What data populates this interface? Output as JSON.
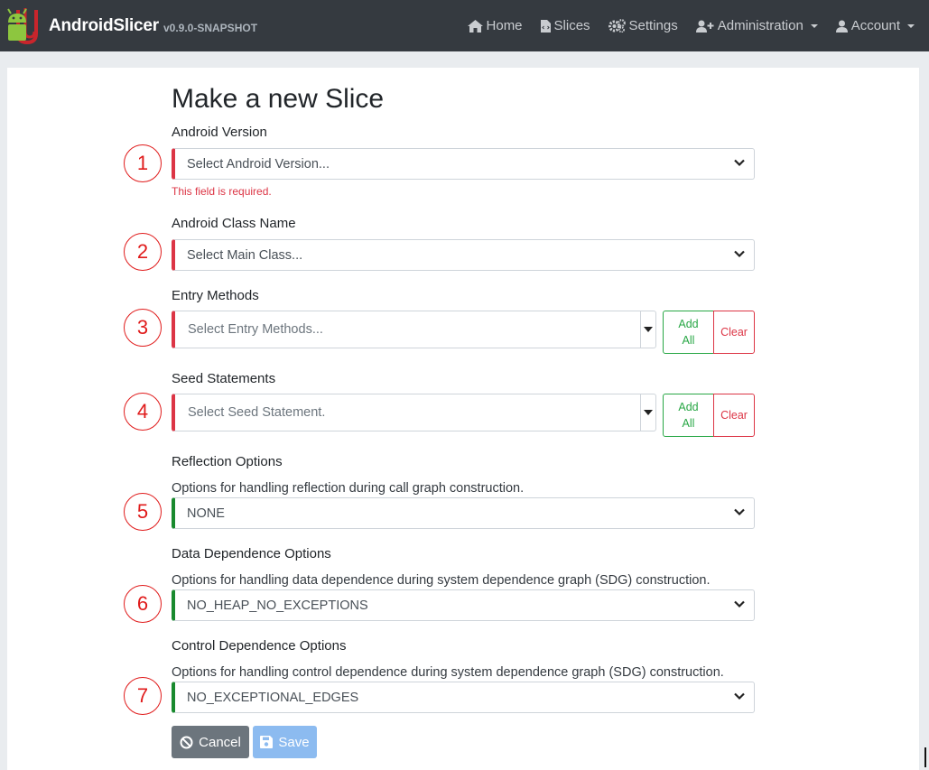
{
  "navbar": {
    "brand_name": "AndroidSlicer",
    "brand_version": "v0.9.0-SNAPSHOT",
    "items": {
      "home": "Home",
      "slices": "Slices",
      "settings": "Settings",
      "administration": "Administration",
      "account": "Account"
    }
  },
  "form": {
    "title": "Make a new Slice",
    "android_version": {
      "label": "Android Version",
      "placeholder": "Select Android Version...",
      "error": "This field is required.",
      "marker": "1"
    },
    "class_name": {
      "label": "Android Class Name",
      "placeholder": "Select Main Class...",
      "marker": "2"
    },
    "entry_methods": {
      "label": "Entry Methods",
      "placeholder": "Select Entry Methods...",
      "add_line1": "Add",
      "add_line2": "All",
      "clear": "Clear",
      "marker": "3"
    },
    "seed_statements": {
      "label": "Seed Statements",
      "placeholder": "Select Seed Statement.",
      "add_line1": "Add",
      "add_line2": "All",
      "clear": "Clear",
      "marker": "4"
    },
    "reflection": {
      "label": "Reflection Options",
      "help": "Options for handling reflection during call graph construction.",
      "value": "NONE",
      "marker": "5"
    },
    "data_dependence": {
      "label": "Data Dependence Options",
      "help": "Options for handling data dependence during system dependence graph (SDG) construction.",
      "value": "NO_HEAP_NO_EXCEPTIONS",
      "marker": "6"
    },
    "control_dependence": {
      "label": "Control Dependence Options",
      "help": "Options for handling control dependence during system dependence graph (SDG) construction.",
      "value": "NO_EXCEPTIONAL_EDGES",
      "marker": "7"
    },
    "cancel_label": "Cancel",
    "save_label": "Save"
  },
  "colors": {
    "navbar_bg": "#353a40",
    "invalid": "#dc3545",
    "valid": "#198a2e",
    "marker": "#e01b1b",
    "save_button": "#8cbbf0",
    "cancel_button": "#6c757d"
  }
}
